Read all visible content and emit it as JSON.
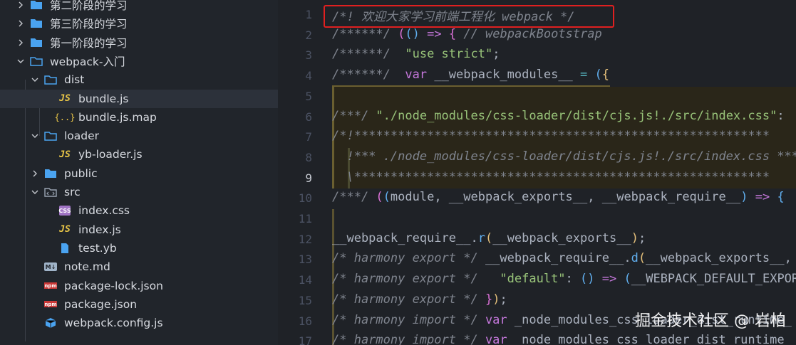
{
  "sidebar": {
    "items": [
      {
        "label": "第二阶段的学习",
        "kind": "folder",
        "expanded": false,
        "depth": 0
      },
      {
        "label": "第三阶段的学习",
        "kind": "folder",
        "expanded": false,
        "depth": 0
      },
      {
        "label": "第一阶段的学习",
        "kind": "folder",
        "expanded": false,
        "depth": 0
      },
      {
        "label": "webpack-入门",
        "kind": "folder",
        "expanded": true,
        "depth": 0
      },
      {
        "label": "dist",
        "kind": "folder",
        "expanded": true,
        "depth": 1
      },
      {
        "label": "bundle.js",
        "kind": "js",
        "depth": 2,
        "selected": true
      },
      {
        "label": "bundle.js.map",
        "kind": "map",
        "depth": 2
      },
      {
        "label": "loader",
        "kind": "folder",
        "expanded": true,
        "depth": 1
      },
      {
        "label": "yb-loader.js",
        "kind": "js",
        "depth": 2
      },
      {
        "label": "public",
        "kind": "folder",
        "expanded": false,
        "depth": 1
      },
      {
        "label": "src",
        "kind": "src-folder",
        "expanded": true,
        "depth": 1
      },
      {
        "label": "index.css",
        "kind": "css",
        "depth": 2
      },
      {
        "label": "index.js",
        "kind": "js",
        "depth": 2
      },
      {
        "label": "test.yb",
        "kind": "file",
        "depth": 2
      },
      {
        "label": "note.md",
        "kind": "md",
        "depth": 1
      },
      {
        "label": "package-lock.json",
        "kind": "npm",
        "depth": 1
      },
      {
        "label": "package.json",
        "kind": "npm",
        "depth": 1
      },
      {
        "label": "webpack.config.js",
        "kind": "webpack",
        "depth": 1
      }
    ],
    "badges": {
      "js": "JS",
      "map": "{..}",
      "css": "CSS",
      "md": "M↓",
      "npm": "npm"
    }
  },
  "editor": {
    "active_line": 9,
    "lines": [
      {
        "n": "1",
        "parts": [
          {
            "t": "/*! 欢迎大家学习前端工程化 webpack */",
            "c": "cm"
          }
        ]
      },
      {
        "n": "2",
        "parts": [
          {
            "t": "/******/ ",
            "c": "cm"
          },
          {
            "t": "(",
            "c": "pk"
          },
          {
            "t": "() ",
            "c": "fn"
          },
          {
            "t": "=>",
            "c": "kw"
          },
          {
            "t": " ",
            "c": ""
          },
          {
            "t": "{",
            "c": "pk"
          },
          {
            "t": " // webpackBootstrap",
            "c": "cm"
          }
        ]
      },
      {
        "n": "3",
        "parts": [
          {
            "t": "/******/ ",
            "c": "cm"
          },
          {
            "t": " ",
            "c": ""
          },
          {
            "t": "\"use strict\"",
            "c": "str"
          },
          {
            "t": ";",
            "c": ""
          }
        ]
      },
      {
        "n": "4",
        "parts": [
          {
            "t": "/******/ ",
            "c": "cm"
          },
          {
            "t": " ",
            "c": ""
          },
          {
            "t": "var",
            "c": "kw"
          },
          {
            "t": " __webpack_modules__ ",
            "c": ""
          },
          {
            "t": "=",
            "c": "op"
          },
          {
            "t": " ",
            "c": ""
          },
          {
            "t": "(",
            "c": "fn"
          },
          {
            "t": "{",
            "c": "br"
          }
        ]
      },
      {
        "n": "5",
        "parts": []
      },
      {
        "n": "6",
        "parts": [
          {
            "t": "/***/ ",
            "c": "cm"
          },
          {
            "t": "\"./node_modules/css-loader/dist/cjs.js!./src/index.css\"",
            "c": "str"
          },
          {
            "t": ":",
            "c": ""
          }
        ]
      },
      {
        "n": "7",
        "parts": [
          {
            "t": "/*!*********************************************************",
            "c": "cm"
          }
        ]
      },
      {
        "n": "8",
        "parts": [
          {
            "t": "  !*** ./node_modules/css-loader/dist/cjs.js!./src/index.css ***!",
            "c": "cm"
          }
        ]
      },
      {
        "n": "9",
        "parts": [
          {
            "t": "  \\*********************************************************",
            "c": "cm"
          }
        ]
      },
      {
        "n": "10",
        "parts": [
          {
            "t": "/***/ ",
            "c": "cm"
          },
          {
            "t": "(",
            "c": "pk"
          },
          {
            "t": "(",
            "c": "fn"
          },
          {
            "t": "module, __webpack_exports__, __webpack_require__",
            "c": ""
          },
          {
            "t": ")",
            "c": "fn"
          },
          {
            "t": " ",
            "c": ""
          },
          {
            "t": "=>",
            "c": "kw"
          },
          {
            "t": " ",
            "c": ""
          },
          {
            "t": "{",
            "c": "fn"
          }
        ]
      },
      {
        "n": "11",
        "parts": []
      },
      {
        "n": "12",
        "parts": [
          {
            "t": "__webpack_require__",
            "c": ""
          },
          {
            "t": ".",
            "c": ""
          },
          {
            "t": "r",
            "c": "fn"
          },
          {
            "t": "(",
            "c": "br"
          },
          {
            "t": "__webpack_exports__",
            "c": ""
          },
          {
            "t": ")",
            "c": "br"
          },
          {
            "t": ";",
            "c": ""
          }
        ]
      },
      {
        "n": "13",
        "parts": [
          {
            "t": "/* harmony export */ ",
            "c": "cm"
          },
          {
            "t": "__webpack_require__",
            "c": ""
          },
          {
            "t": ".",
            "c": ""
          },
          {
            "t": "d",
            "c": "fn"
          },
          {
            "t": "(",
            "c": "br"
          },
          {
            "t": "__webpack_exports__, ",
            "c": ""
          },
          {
            "t": "{",
            "c": "pk"
          }
        ]
      },
      {
        "n": "14",
        "parts": [
          {
            "t": "/* harmony export */ ",
            "c": "cm"
          },
          {
            "t": "  ",
            "c": ""
          },
          {
            "t": "\"default\"",
            "c": "str"
          },
          {
            "t": ": ",
            "c": ""
          },
          {
            "t": "()",
            "c": "fn"
          },
          {
            "t": " ",
            "c": ""
          },
          {
            "t": "=>",
            "c": "kw"
          },
          {
            "t": " ",
            "c": ""
          },
          {
            "t": "(",
            "c": "fn"
          },
          {
            "t": "__WEBPACK_DEFAULT_EXPORT__",
            "c": ""
          }
        ]
      },
      {
        "n": "15",
        "parts": [
          {
            "t": "/* harmony export */ ",
            "c": "cm"
          },
          {
            "t": "}",
            "c": "pk"
          },
          {
            "t": ")",
            "c": "br"
          },
          {
            "t": ";",
            "c": ""
          }
        ]
      },
      {
        "n": "16",
        "parts": [
          {
            "t": "/* harmony import */ ",
            "c": "cm"
          },
          {
            "t": "var",
            "c": "kw"
          },
          {
            "t": " _node_modules_css_loader_dist_runtime_",
            "c": ""
          }
        ]
      },
      {
        "n": "17",
        "parts": [
          {
            "t": "/* harmony import */ ",
            "c": "cm"
          },
          {
            "t": "var",
            "c": "kw"
          },
          {
            "t": " _node_modules_css_loader_dist_runtime_",
            "c": ""
          }
        ]
      }
    ]
  },
  "watermark": "掘金技术社区 @ 岩柏",
  "colors": {
    "highlight": "#e02020",
    "folder": "#4aa3f0",
    "sidebar_bg": "#21252b",
    "editor_bg": "#1f2227"
  }
}
